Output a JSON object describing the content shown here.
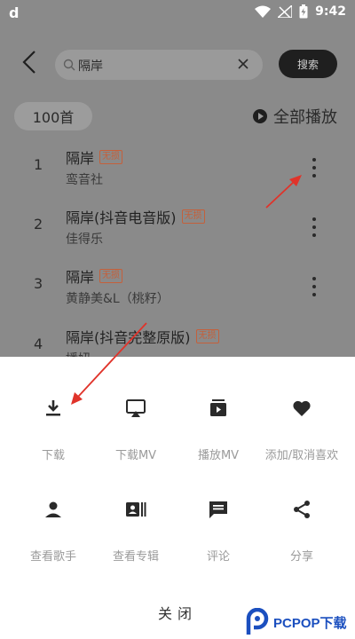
{
  "statusbar": {
    "left_glyph": "d",
    "time": "9:42"
  },
  "search": {
    "query": "隔岸",
    "button_label": "搜索"
  },
  "list": {
    "count_label": "100首",
    "play_all_label": "全部播放",
    "songs": [
      {
        "index": "1",
        "title": "隔岸",
        "badge": "无损",
        "artist": "鸾音社"
      },
      {
        "index": "2",
        "title": "隔岸(抖音电音版)",
        "badge": "无损",
        "artist": "佳得乐"
      },
      {
        "index": "3",
        "title": "隔岸",
        "badge": "无损",
        "artist": "黄静美&L（桃籽）"
      },
      {
        "index": "4",
        "title": "隔岸(抖音完整原版)",
        "badge": "无损",
        "artist": "播妞"
      }
    ]
  },
  "sheet": {
    "actions": [
      {
        "label": "下载",
        "icon": "download-icon"
      },
      {
        "label": "下载MV",
        "icon": "cast-icon"
      },
      {
        "label": "播放MV",
        "icon": "play-mv-icon"
      },
      {
        "label": "添加/取消喜欢",
        "icon": "heart-icon"
      },
      {
        "label": "查看歌手",
        "icon": "person-icon"
      },
      {
        "label": "查看专辑",
        "icon": "album-icon"
      },
      {
        "label": "评论",
        "icon": "comment-icon"
      },
      {
        "label": "分享",
        "icon": "share-icon"
      }
    ],
    "close_label": "关闭"
  },
  "watermark": {
    "text": "PCPOP下载"
  },
  "colors": {
    "overlay": "#8a8a8a",
    "accent_red": "#e0332a",
    "badge": "#c4603b",
    "brand_blue": "#1b4fbf"
  }
}
